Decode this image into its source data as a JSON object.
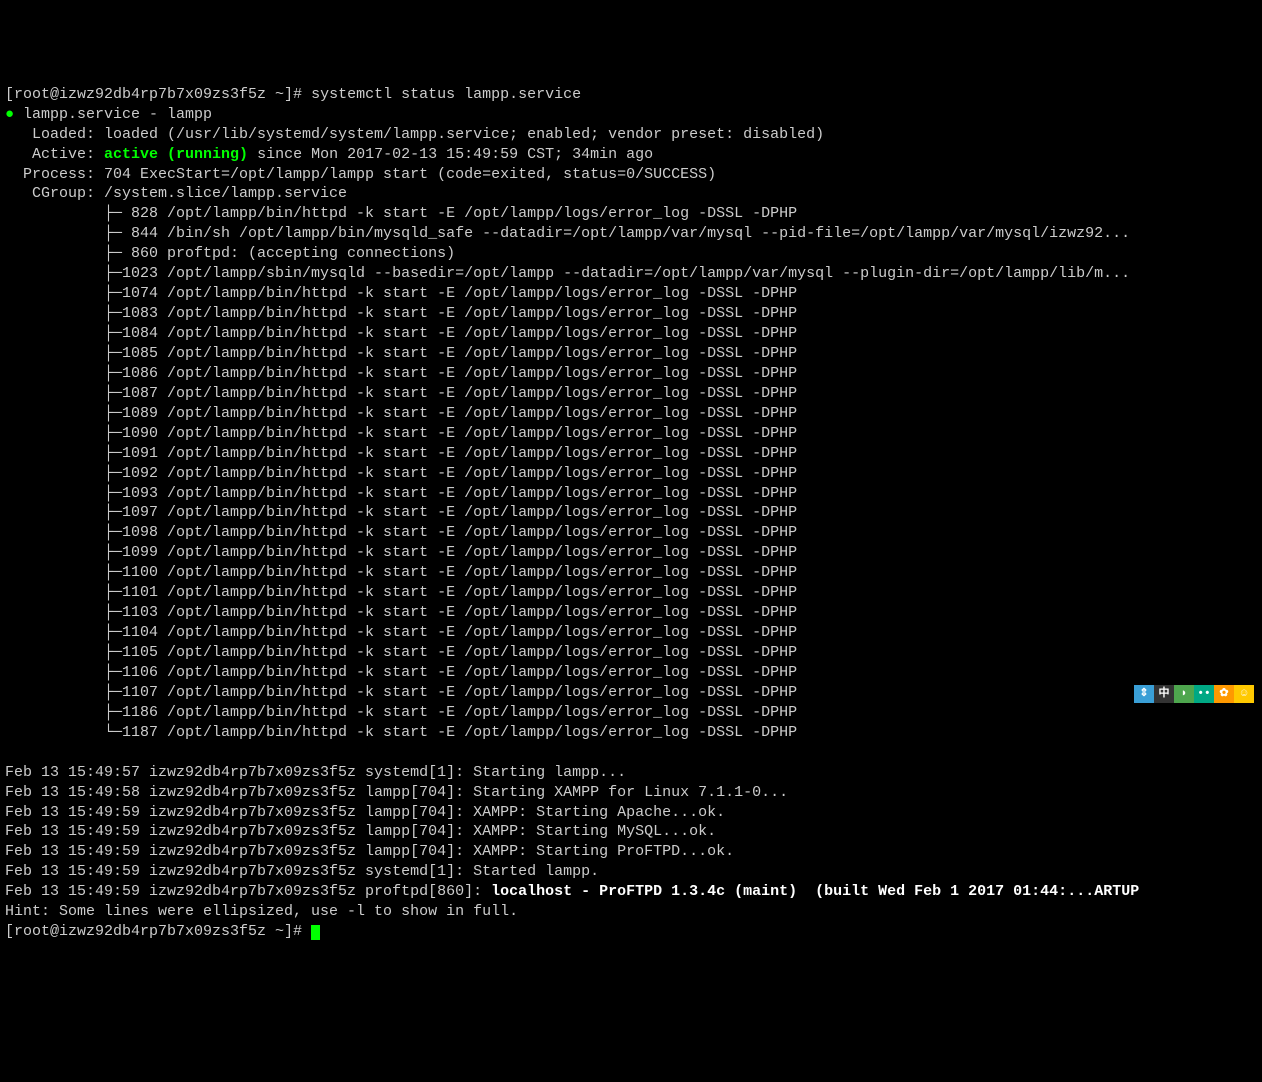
{
  "prompt": "[root@izwz92db4rp7b7x09zs3f5z ~]# ",
  "command": "systemctl status lampp.service",
  "status": {
    "unit": "lampp.service - lampp",
    "loaded": "   Loaded: loaded (/usr/lib/systemd/system/lampp.service; enabled; vendor preset: disabled)",
    "active_label": "   Active: ",
    "active_status": "active (running)",
    "active_rest": " since Mon 2017-02-13 15:49:59 CST; 34min ago",
    "process": "  Process: 704 ExecStart=/opt/lampp/lampp start (code=exited, status=0/SUCCESS)",
    "cgroup": "   CGroup: /system.slice/lampp.service"
  },
  "procs": [
    "           ├─ 828 /opt/lampp/bin/httpd -k start -E /opt/lampp/logs/error_log -DSSL -DPHP",
    "           ├─ 844 /bin/sh /opt/lampp/bin/mysqld_safe --datadir=/opt/lampp/var/mysql --pid-file=/opt/lampp/var/mysql/izwz92...",
    "           ├─ 860 proftpd: (accepting connections)",
    "           ├─1023 /opt/lampp/sbin/mysqld --basedir=/opt/lampp --datadir=/opt/lampp/var/mysql --plugin-dir=/opt/lampp/lib/m...",
    "           ├─1074 /opt/lampp/bin/httpd -k start -E /opt/lampp/logs/error_log -DSSL -DPHP",
    "           ├─1083 /opt/lampp/bin/httpd -k start -E /opt/lampp/logs/error_log -DSSL -DPHP",
    "           ├─1084 /opt/lampp/bin/httpd -k start -E /opt/lampp/logs/error_log -DSSL -DPHP",
    "           ├─1085 /opt/lampp/bin/httpd -k start -E /opt/lampp/logs/error_log -DSSL -DPHP",
    "           ├─1086 /opt/lampp/bin/httpd -k start -E /opt/lampp/logs/error_log -DSSL -DPHP",
    "           ├─1087 /opt/lampp/bin/httpd -k start -E /opt/lampp/logs/error_log -DSSL -DPHP",
    "           ├─1089 /opt/lampp/bin/httpd -k start -E /opt/lampp/logs/error_log -DSSL -DPHP",
    "           ├─1090 /opt/lampp/bin/httpd -k start -E /opt/lampp/logs/error_log -DSSL -DPHP",
    "           ├─1091 /opt/lampp/bin/httpd -k start -E /opt/lampp/logs/error_log -DSSL -DPHP",
    "           ├─1092 /opt/lampp/bin/httpd -k start -E /opt/lampp/logs/error_log -DSSL -DPHP",
    "           ├─1093 /opt/lampp/bin/httpd -k start -E /opt/lampp/logs/error_log -DSSL -DPHP",
    "           ├─1097 /opt/lampp/bin/httpd -k start -E /opt/lampp/logs/error_log -DSSL -DPHP",
    "           ├─1098 /opt/lampp/bin/httpd -k start -E /opt/lampp/logs/error_log -DSSL -DPHP",
    "           ├─1099 /opt/lampp/bin/httpd -k start -E /opt/lampp/logs/error_log -DSSL -DPHP",
    "           ├─1100 /opt/lampp/bin/httpd -k start -E /opt/lampp/logs/error_log -DSSL -DPHP",
    "           ├─1101 /opt/lampp/bin/httpd -k start -E /opt/lampp/logs/error_log -DSSL -DPHP",
    "           ├─1103 /opt/lampp/bin/httpd -k start -E /opt/lampp/logs/error_log -DSSL -DPHP",
    "           ├─1104 /opt/lampp/bin/httpd -k start -E /opt/lampp/logs/error_log -DSSL -DPHP",
    "           ├─1105 /opt/lampp/bin/httpd -k start -E /opt/lampp/logs/error_log -DSSL -DPHP",
    "           ├─1106 /opt/lampp/bin/httpd -k start -E /opt/lampp/logs/error_log -DSSL -DPHP",
    "           ├─1107 /opt/lampp/bin/httpd -k start -E /opt/lampp/logs/error_log -DSSL -DPHP",
    "           ├─1186 /opt/lampp/bin/httpd -k start -E /opt/lampp/logs/error_log -DSSL -DPHP",
    "           └─1187 /opt/lampp/bin/httpd -k start -E /opt/lampp/logs/error_log -DSSL -DPHP"
  ],
  "log": [
    "Feb 13 15:49:57 izwz92db4rp7b7x09zs3f5z systemd[1]: Starting lampp...",
    "Feb 13 15:49:58 izwz92db4rp7b7x09zs3f5z lampp[704]: Starting XAMPP for Linux 7.1.1-0...",
    "Feb 13 15:49:59 izwz92db4rp7b7x09zs3f5z lampp[704]: XAMPP: Starting Apache...ok.",
    "Feb 13 15:49:59 izwz92db4rp7b7x09zs3f5z lampp[704]: XAMPP: Starting MySQL...ok.",
    "Feb 13 15:49:59 izwz92db4rp7b7x09zs3f5z lampp[704]: XAMPP: Starting ProFTPD...ok.",
    "Feb 13 15:49:59 izwz92db4rp7b7x09zs3f5z systemd[1]: Started lampp."
  ],
  "log_bold": {
    "prefix": "Feb 13 15:49:59 izwz92db4rp7b7x09zs3f5z proftpd[860]: ",
    "msg": "localhost - ProFTPD 1.3.4c (maint)  (built Wed Feb 1 2017 01:44:...ARTUP"
  },
  "hint": "Hint: Some lines were ellipsized, use -l to show in full.",
  "prompt2": "[root@izwz92db4rp7b7x09zs3f5z ~]# ",
  "toolbar": {
    "t0": "⇕",
    "t1": "中",
    "t2": "◗",
    "t3": "••",
    "t4": "✿",
    "t5": "☺"
  }
}
